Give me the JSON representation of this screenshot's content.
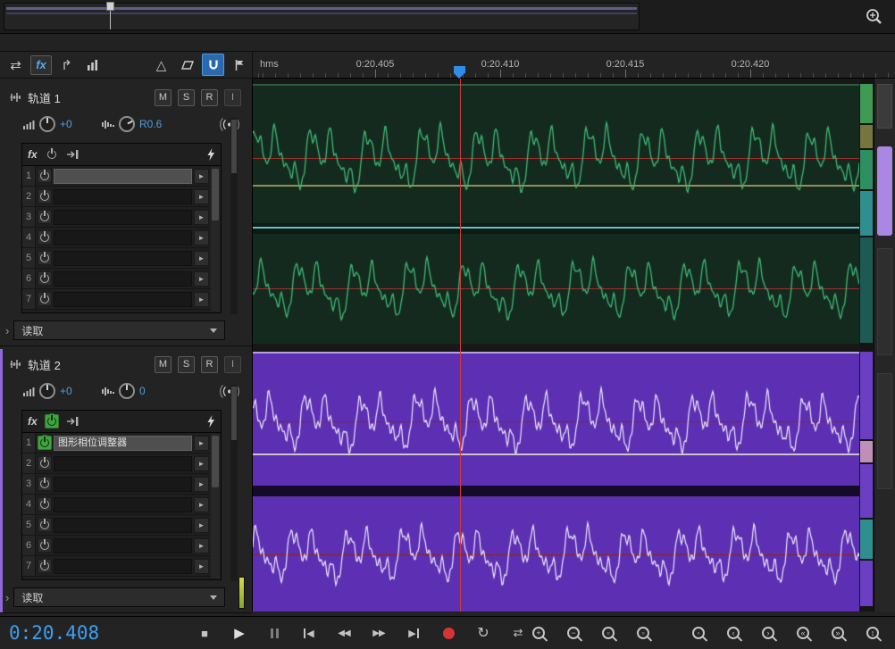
{
  "toolbar": {
    "fx_label": "fx"
  },
  "ruler": {
    "unit": "hms",
    "ticks": [
      "0:20.405",
      "0:20.410",
      "0:20.415",
      "0:20.420"
    ]
  },
  "tracks": [
    {
      "name": "轨道 1",
      "mute": "M",
      "solo": "S",
      "arm": "R",
      "input": "I",
      "volume": "+0",
      "pan": "R0.6",
      "fx_label": "fx",
      "automation_mode": "读取",
      "fx_slots": [
        {
          "num": "1",
          "name": "",
          "enabled": false
        },
        {
          "num": "2",
          "name": "",
          "enabled": false
        },
        {
          "num": "3",
          "name": "",
          "enabled": false
        },
        {
          "num": "4",
          "name": "",
          "enabled": false
        },
        {
          "num": "5",
          "name": "",
          "enabled": false
        },
        {
          "num": "6",
          "name": "",
          "enabled": false
        },
        {
          "num": "7",
          "name": "",
          "enabled": false
        }
      ]
    },
    {
      "name": "轨道 2",
      "mute": "M",
      "solo": "S",
      "arm": "R",
      "input": "I",
      "volume": "+0",
      "pan": "0",
      "fx_label": "fx",
      "automation_mode": "读取",
      "fx_slots": [
        {
          "num": "1",
          "name": "图形相位调整器",
          "enabled": true
        },
        {
          "num": "2",
          "name": "",
          "enabled": false
        },
        {
          "num": "3",
          "name": "",
          "enabled": false
        },
        {
          "num": "4",
          "name": "",
          "enabled": false
        },
        {
          "num": "5",
          "name": "",
          "enabled": false
        },
        {
          "num": "6",
          "name": "",
          "enabled": false
        },
        {
          "num": "7",
          "name": "",
          "enabled": false
        }
      ]
    }
  ],
  "transport": {
    "time": "0:20.408"
  },
  "icons": {
    "move_tool": "⇄",
    "slip_tool": "↱",
    "metronome": "△",
    "chevron": "›",
    "fx_arrow": "►",
    "stop": "■",
    "play": "▶",
    "tri_left": "◀",
    "tri_right": "▶",
    "rewind": "◀◀",
    "forward": "▶▶",
    "loop": "↻",
    "shuttle": "⇄"
  },
  "zooms": [
    {
      "glyph": "+"
    },
    {
      "glyph": "−"
    },
    {
      "glyph": "▫"
    },
    {
      "glyph": "▫"
    },
    {
      "glyph": "◦"
    },
    {
      "glyph": "‹"
    },
    {
      "glyph": "›"
    },
    {
      "glyph": "«"
    },
    {
      "glyph": "»"
    },
    {
      "glyph": "↕"
    }
  ],
  "colors": {
    "accent_blue": "#2f8de8",
    "value_blue": "#4f9fe0",
    "record_red": "#d63434",
    "playhead_red": "#d23a3a",
    "fx_on_green": "#3fa43f",
    "track1_wave": "#3dbb77",
    "track2_clip": "#5c2fb3"
  }
}
